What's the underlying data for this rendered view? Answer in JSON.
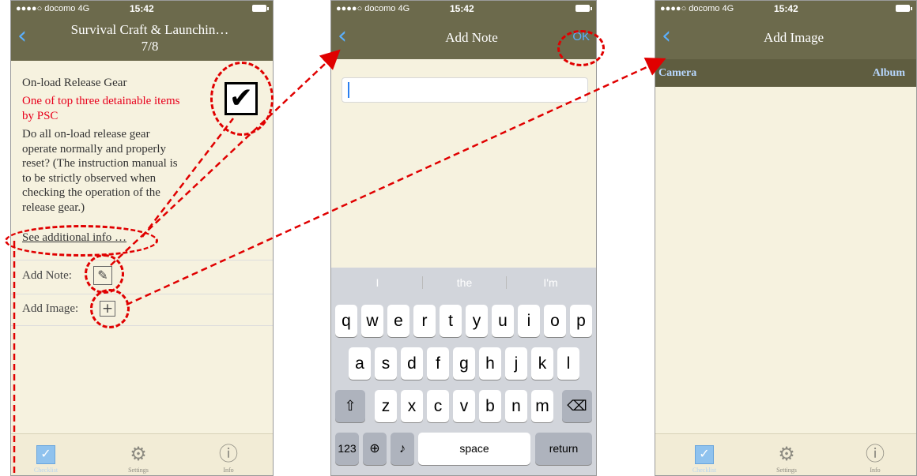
{
  "status": {
    "carrier": "●●●●○ docomo  4G",
    "time": "15:42"
  },
  "screen1": {
    "title_line1": "Survival Craft & Launchin…",
    "title_line2": "7/8",
    "item_title": "On-load Release Gear",
    "warning_line1": "One of top three detainable items",
    "warning_line2": "by PSC",
    "question_lines": [
      "Do all on-load release gear",
      "operate normally and properly",
      "reset? (The instruction manual is",
      "to be strictly observed when",
      "checking the operation of the",
      "release gear.)"
    ],
    "additional_info": "See additional info …",
    "add_note_label": "Add Note:",
    "add_image_label": "Add Image:",
    "checkbox_checked": true
  },
  "screen2": {
    "title": "Add Note",
    "ok_label": "OK",
    "note_value": "",
    "suggestions": [
      "I",
      "the",
      "I'm"
    ],
    "row1": [
      "q",
      "w",
      "e",
      "r",
      "t",
      "y",
      "u",
      "i",
      "o",
      "p"
    ],
    "row2": [
      "a",
      "s",
      "d",
      "f",
      "g",
      "h",
      "j",
      "k",
      "l"
    ],
    "row3": [
      "z",
      "x",
      "c",
      "v",
      "b",
      "n",
      "m"
    ],
    "numbers_key": "123",
    "space_key": "space",
    "return_key": "return"
  },
  "screen3": {
    "title": "Add Image",
    "camera_label": "Camera",
    "album_label": "Album"
  },
  "tabbar": {
    "checklist": "Checklist",
    "settings": "Settings",
    "info": "Info"
  },
  "colors": {
    "navbar": "#6c6a4c",
    "background": "#f6f2df",
    "accent": "#5ab0ff",
    "warning": "#e8001c",
    "annotation": "#e00000"
  }
}
